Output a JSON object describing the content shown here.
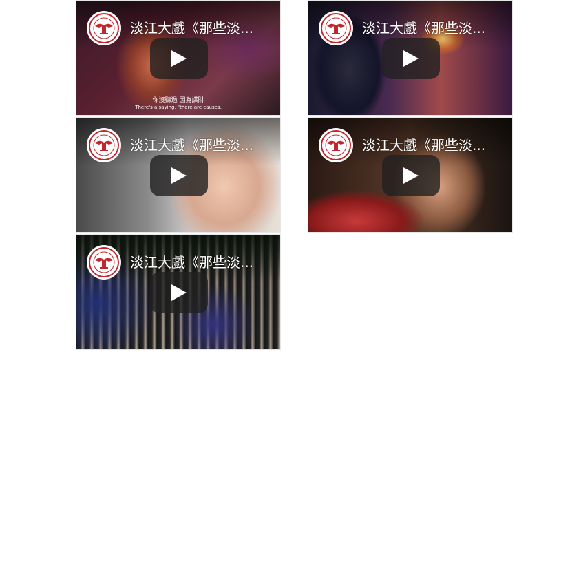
{
  "videos": [
    {
      "title": "淡江大戲《那些淡...",
      "subtitle_zh": "你沒聽過 因為謀財",
      "subtitle_en": "There's a saying, \"there are causes,",
      "logo_color": "#c0262d"
    },
    {
      "title": "淡江大戲《那些淡...",
      "logo_color": "#c0262d"
    },
    {
      "title": "淡江大戲《那些淡...",
      "logo_color": "#c0262d"
    },
    {
      "title": "淡江大戲《那些淡...",
      "logo_color": "#c0262d"
    },
    {
      "title": "淡江大戲《那些淡...",
      "logo_color": "#c0262d"
    }
  ],
  "icons": {
    "play": "play-icon",
    "logo": "university-seal-icon"
  }
}
